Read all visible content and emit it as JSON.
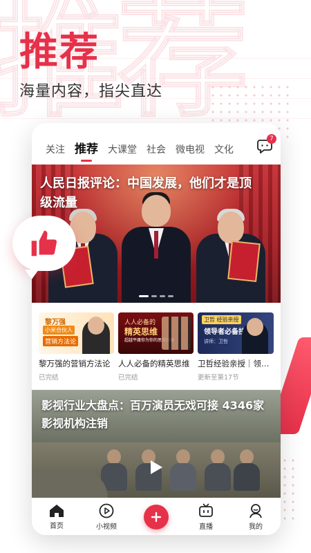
{
  "promo": {
    "title": "推荐",
    "subtitle": "海量内容，指尖直达",
    "watermark": "推荐"
  },
  "tabs": [
    {
      "label": "关注",
      "active": false
    },
    {
      "label": "推荐",
      "active": true
    },
    {
      "label": "大课堂",
      "active": false
    },
    {
      "label": "社会",
      "active": false
    },
    {
      "label": "微电视",
      "active": false
    },
    {
      "label": "文化",
      "active": false
    }
  ],
  "messages": {
    "badge": "7",
    "icon": "chat-bubble-icon"
  },
  "hero": {
    "title": "人民日报评论：中国发展，他们才是顶级流量",
    "carousel_count": 4,
    "carousel_active": 0
  },
  "courses": [
    {
      "title": "黎万强的营销方法论",
      "status": "已完结",
      "thumb": {
        "line1": "黎万强",
        "line2": "小米合伙人",
        "line3": "营销方法论"
      }
    },
    {
      "title": "人人必备的精英思维",
      "status": "已完结",
      "thumb": {
        "line1": "人人必备的",
        "line2": "精英思维",
        "line3": "超越平庸你为你的思维升级"
      }
    },
    {
      "title": "卫哲经验亲授｜领导者必备技能",
      "status": "更新至第17节",
      "thumb": {
        "line1": "卫哲 经验亲授",
        "line2": "领导者必备技能",
        "line3": "讲师：卫哲"
      }
    }
  ],
  "video": {
    "title": "影视行业大盘点：百万演员无戏可接 4346家影视机构注销"
  },
  "bottom_nav": [
    {
      "label": "首页",
      "icon": "home-icon",
      "active": true
    },
    {
      "label": "小视频",
      "icon": "play-circle-icon",
      "active": false
    },
    {
      "label": "",
      "icon": "plus-icon",
      "active": false
    },
    {
      "label": "直播",
      "icon": "tv-icon",
      "active": false
    },
    {
      "label": "我的",
      "icon": "user-icon",
      "active": false
    }
  ],
  "colors": {
    "accent": "#e6314a",
    "text": "#222222",
    "muted": "#999999"
  }
}
